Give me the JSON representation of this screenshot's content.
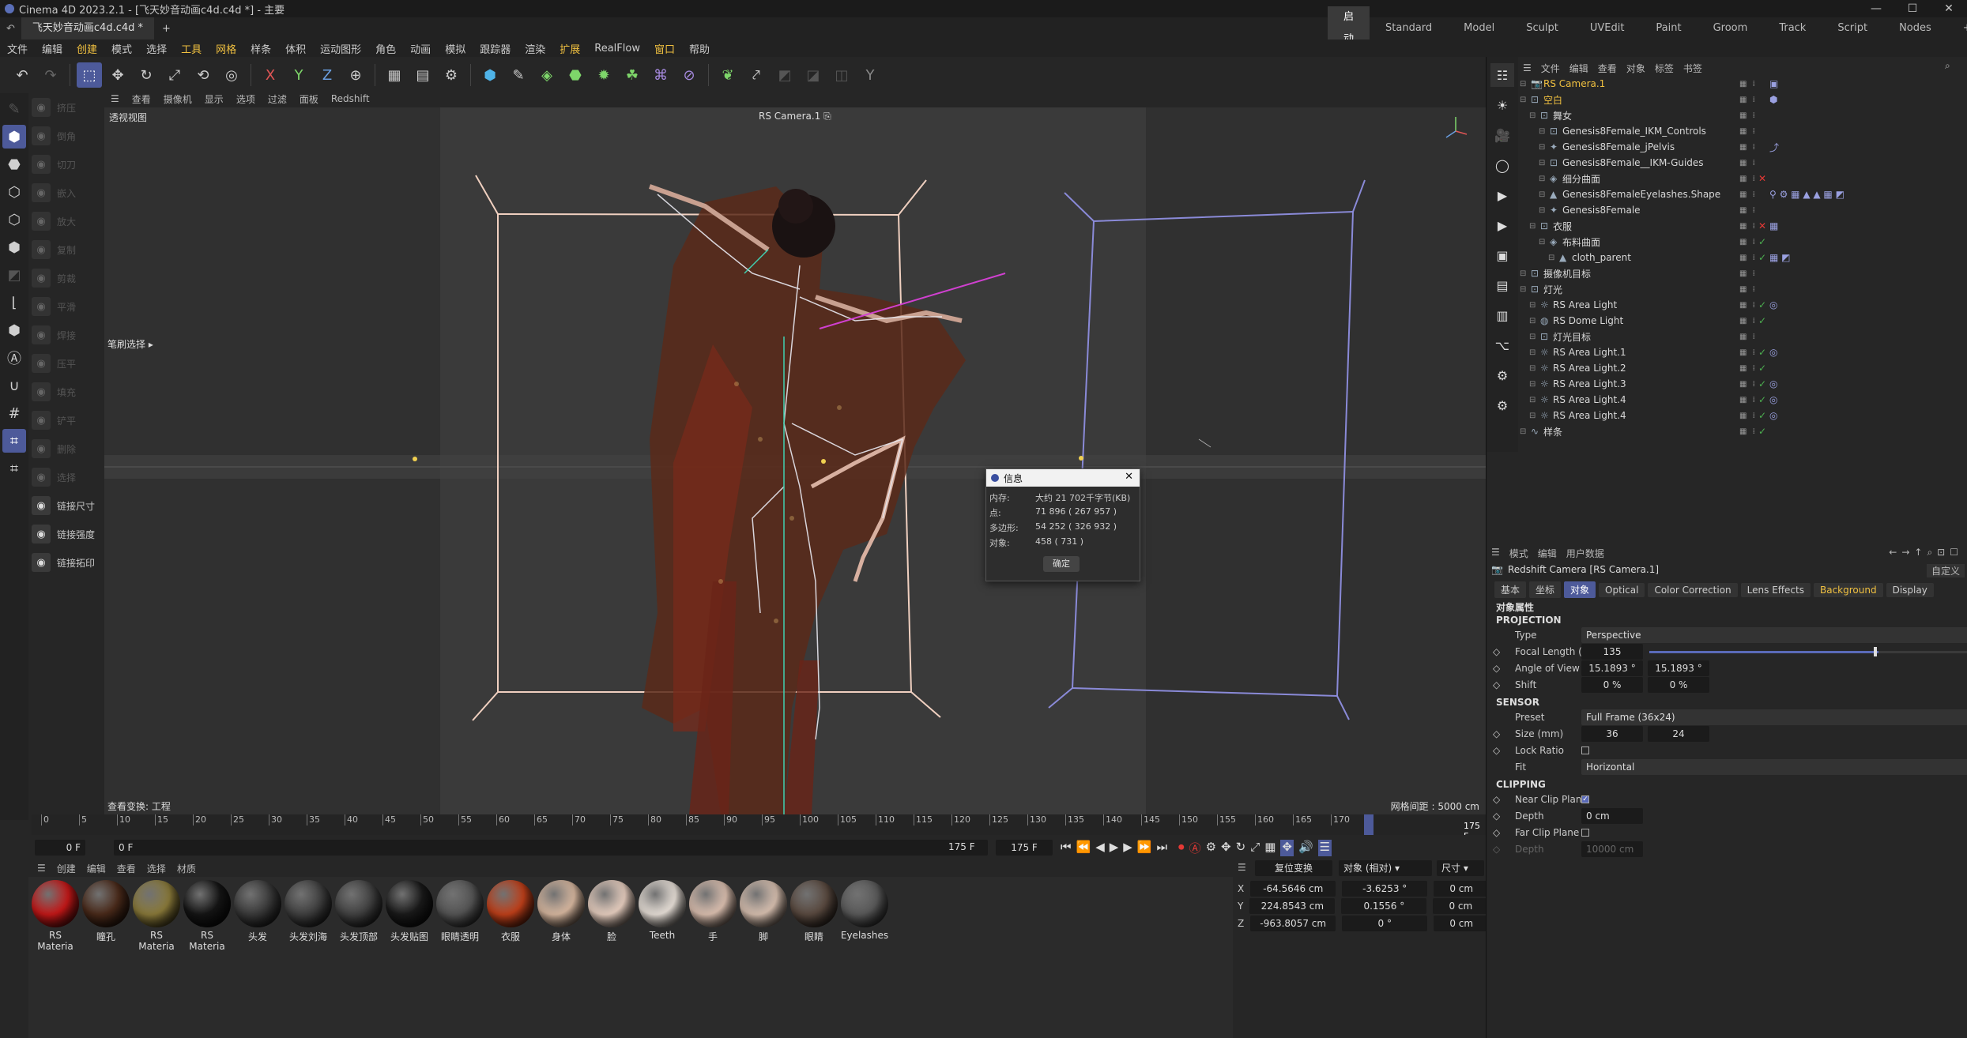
{
  "titlebar": {
    "title": "Cinema 4D 2023.2.1 - [飞天妙音动画c4d.c4d *] - 主要",
    "min": "—",
    "max": "☐",
    "close": "✕"
  },
  "tabs": {
    "doc": "飞天妙音动画c4d.c4d *",
    "add": "+"
  },
  "layouts": [
    "启动",
    "Standard",
    "Model",
    "Sculpt",
    "UVEdit",
    "Paint",
    "Groom",
    "Track",
    "Script",
    "Nodes"
  ],
  "layout_add": "+",
  "menu": [
    "文件",
    "编辑",
    "创建",
    "模式",
    "选择",
    "工具",
    "网格",
    "样条",
    "体积",
    "运动图形",
    "角色",
    "动画",
    "模拟",
    "跟踪器",
    "渲染",
    "扩展",
    "RealFlow",
    "窗口",
    "帮助"
  ],
  "left_tools": [
    {
      "label": "挤压",
      "enabled": false
    },
    {
      "label": "倒角",
      "enabled": false
    },
    {
      "label": "切刀",
      "enabled": false
    },
    {
      "label": "嵌入",
      "enabled": false
    },
    {
      "label": "放大",
      "enabled": false
    },
    {
      "label": "复制",
      "enabled": false
    },
    {
      "label": "剪裁",
      "enabled": false
    },
    {
      "label": "平滑",
      "enabled": false
    },
    {
      "label": "焊接",
      "enabled": false
    },
    {
      "label": "压平",
      "enabled": false
    },
    {
      "label": "填充",
      "enabled": false
    },
    {
      "label": "铲平",
      "enabled": false
    },
    {
      "label": "删除",
      "enabled": false
    },
    {
      "label": "选择",
      "enabled": false
    },
    {
      "label": "链接尺寸",
      "enabled": true
    },
    {
      "label": "链接强度",
      "enabled": true
    },
    {
      "label": "链接拓印",
      "enabled": true
    }
  ],
  "viewport_menu": [
    "查看",
    "摄像机",
    "显示",
    "选项",
    "过滤",
    "面板",
    "Redshift"
  ],
  "viewport": {
    "name": "透视视图",
    "camera": "RS Camera.1",
    "tool_label": "笔刷选择",
    "transform_label": "查看变换: 工程",
    "grid_label": "网格间距 : 5000 cm"
  },
  "timeline": {
    "ticks": [
      "0",
      "5",
      "10",
      "15",
      "20",
      "25",
      "30",
      "35",
      "40",
      "45",
      "50",
      "55",
      "60",
      "65",
      "70",
      "75",
      "80",
      "85",
      "90",
      "95",
      "100",
      "105",
      "110",
      "115",
      "120",
      "125",
      "130",
      "135",
      "140",
      "145",
      "150",
      "155",
      "160",
      "165",
      "170"
    ],
    "max_tick": 175,
    "current_frame_label": "175 F",
    "current_frame": 175
  },
  "transport": {
    "start": "0 F",
    "field2": "0 F",
    "end1": "175 F",
    "end2": "175 F"
  },
  "mat_menu": [
    "创建",
    "编辑",
    "查看",
    "选择",
    "材质"
  ],
  "materials": [
    {
      "name": "RS Materia",
      "color": "#c41818"
    },
    {
      "name": "瞳孔",
      "color": "#4a2a1a"
    },
    {
      "name": "RS Materia",
      "color": "#8a7a3a"
    },
    {
      "name": "RS Materia",
      "color": "#151515"
    },
    {
      "name": "头发",
      "color": "#3a3a3a"
    },
    {
      "name": "头发刘海",
      "color": "#404040"
    },
    {
      "name": "头发顶部",
      "color": "#424242"
    },
    {
      "name": "头发贴图",
      "color": "#1a1a1a"
    },
    {
      "name": "眼睛透明",
      "color": "#555555"
    },
    {
      "name": "衣服",
      "color": "#c0401a"
    },
    {
      "name": "身体",
      "color": "#d8b8a0"
    },
    {
      "name": "脸",
      "color": "#e8cfc0"
    },
    {
      "name": "Teeth",
      "color": "#e8e0d8"
    },
    {
      "name": "手",
      "color": "#dcc0b0"
    },
    {
      "name": "脚",
      "color": "#d8c0b0"
    },
    {
      "name": "眼睛",
      "color": "#5a4a40"
    },
    {
      "name": "Eyelashes",
      "color": "#5a5a5a"
    }
  ],
  "coords": {
    "reset": "复位变换",
    "mode": "对象 (相对)",
    "size_mode": "尺寸",
    "rows": [
      {
        "axis": "X",
        "pos": "-64.5646 cm",
        "rot": "-3.6253 °",
        "size": "0 cm"
      },
      {
        "axis": "Y",
        "pos": "224.8543 cm",
        "rot": "0.1556 °",
        "size": "0 cm"
      },
      {
        "axis": "Z",
        "pos": "-963.8057 cm",
        "rot": "0 °",
        "size": "0 cm"
      }
    ]
  },
  "object_menu": [
    "文件",
    "编辑",
    "查看",
    "对象",
    "标签",
    "书签"
  ],
  "objects": [
    {
      "name": "RS Camera.1",
      "indent": 0,
      "icon": "📷",
      "color": "#f0c040",
      "check": "",
      "tags": "▣"
    },
    {
      "name": "空白",
      "indent": 0,
      "icon": "⊡",
      "color": "#f0c040",
      "check": "",
      "tags": "⬢"
    },
    {
      "name": "舞女",
      "indent": 1,
      "icon": "⊡",
      "color": "#d8d8d8",
      "check": "",
      "tags": ""
    },
    {
      "name": "Genesis8Female_IKM_Controls",
      "indent": 2,
      "icon": "⊡",
      "color": "#d8d8d8",
      "check": "",
      "tags": ""
    },
    {
      "name": "Genesis8Female_jPelvis",
      "indent": 2,
      "icon": "✦",
      "color": "#d8d8d8",
      "check": "",
      "tags": "⤴"
    },
    {
      "name": "Genesis8Female__IKM-Guides",
      "indent": 2,
      "icon": "⊡",
      "color": "#d8d8d8",
      "check": "",
      "tags": ""
    },
    {
      "name": "细分曲面",
      "indent": 2,
      "icon": "◈",
      "color": "#d8d8d8",
      "check": "x",
      "tags": ""
    },
    {
      "name": "Genesis8FemaleEyelashes.Shape",
      "indent": 2,
      "icon": "▲",
      "color": "#d8d8d8",
      "check": "",
      "tags": "⚲ ⚙ ▦ ▲ ▲ ▦ ◩"
    },
    {
      "name": "Genesis8Female",
      "indent": 2,
      "icon": "✦",
      "color": "#d8d8d8",
      "check": "",
      "tags": ""
    },
    {
      "name": "衣服",
      "indent": 1,
      "icon": "⊡",
      "color": "#d8d8d8",
      "check": "x",
      "tags": "▦"
    },
    {
      "name": "布料曲面",
      "indent": 2,
      "icon": "◈",
      "color": "#d8d8d8",
      "check": "✓",
      "tags": ""
    },
    {
      "name": "cloth_parent",
      "indent": 3,
      "icon": "▲",
      "color": "#d8d8d8",
      "check": "✓",
      "tags": "▦ ◩"
    },
    {
      "name": "摄像机目标",
      "indent": 0,
      "icon": "⊡",
      "color": "#d8d8d8",
      "check": "",
      "tags": ""
    },
    {
      "name": "灯光",
      "indent": 0,
      "icon": "⊡",
      "color": "#d8d8d8",
      "check": "",
      "tags": ""
    },
    {
      "name": "RS Area Light",
      "indent": 1,
      "icon": "☼",
      "color": "#d8d8d8",
      "check": "✓",
      "tags": "◎"
    },
    {
      "name": "RS Dome Light",
      "indent": 1,
      "icon": "◍",
      "color": "#d8d8d8",
      "check": "✓",
      "tags": ""
    },
    {
      "name": "灯光目标",
      "indent": 1,
      "icon": "⊡",
      "color": "#d8d8d8",
      "check": "",
      "tags": ""
    },
    {
      "name": "RS Area Light.1",
      "indent": 1,
      "icon": "☼",
      "color": "#d8d8d8",
      "check": "✓",
      "tags": "◎"
    },
    {
      "name": "RS Area Light.2",
      "indent": 1,
      "icon": "☼",
      "color": "#d8d8d8",
      "check": "✓",
      "tags": ""
    },
    {
      "name": "RS Area Light.3",
      "indent": 1,
      "icon": "☼",
      "color": "#d8d8d8",
      "check": "✓",
      "tags": "◎"
    },
    {
      "name": "RS Area Light.4",
      "indent": 1,
      "icon": "☼",
      "color": "#d8d8d8",
      "check": "✓",
      "tags": "◎"
    },
    {
      "name": "RS Area Light.4",
      "indent": 1,
      "icon": "☼",
      "color": "#d8d8d8",
      "check": "✓",
      "tags": "◎"
    },
    {
      "name": "样条",
      "indent": 0,
      "icon": "∿",
      "color": "#d8d8d8",
      "check": "✓",
      "tags": ""
    }
  ],
  "attr_menu": [
    "模式",
    "编辑",
    "用户数据"
  ],
  "attr": {
    "title": "Redshift Camera [RS Camera.1]",
    "custom": "自定义",
    "tabs": [
      {
        "label": "基本",
        "style": "bg"
      },
      {
        "label": "坐标",
        "style": "bg"
      },
      {
        "label": "对象",
        "style": "sel"
      },
      {
        "label": "Optical",
        "style": "bg"
      },
      {
        "label": "Color Correction",
        "style": "bg"
      },
      {
        "label": "Lens Effects",
        "style": "bg"
      },
      {
        "label": "Background",
        "style": "yl"
      },
      {
        "label": "Display",
        "style": "bg"
      }
    ],
    "section_title": "对象属性",
    "projection": "PROJECTION",
    "type_label": "Type",
    "type_value": "Perspective",
    "focal_label": "Focal Length (mm)",
    "focal_value": "135",
    "aov_label": "Angle of View",
    "aov_h": "15.1893 °",
    "aov_v": "15.1893 °",
    "shift_label": "Shift",
    "shift_x": "0 %",
    "shift_y": "0 %",
    "sensor": "SENSOR",
    "preset_label": "Preset",
    "preset_value": "Full Frame (36x24)",
    "size_label": "Size (mm)",
    "size_w": "36",
    "size_h": "24",
    "lock_label": "Lock Ratio",
    "fit_label": "Fit",
    "fit_value": "Horizontal",
    "clipping": "CLIPPING",
    "near_label": "Near Clip Plane",
    "depth_label": "Depth",
    "depth_value": "0 cm",
    "far_label": "Far Clip Plane",
    "depth2_label": "Depth",
    "depth2_value": "10000 cm"
  },
  "dialog": {
    "title": "信息",
    "memory_label": "内存:",
    "memory": "大约 21 702千字节(KB)",
    "points_label": "点:",
    "points": "71 896 ( 267 957 )",
    "polys_label": "多边形:",
    "polys": "54 252 ( 326 932 )",
    "objects_label": "对象:",
    "objects": "458 ( 731 )",
    "ok": "确定"
  }
}
